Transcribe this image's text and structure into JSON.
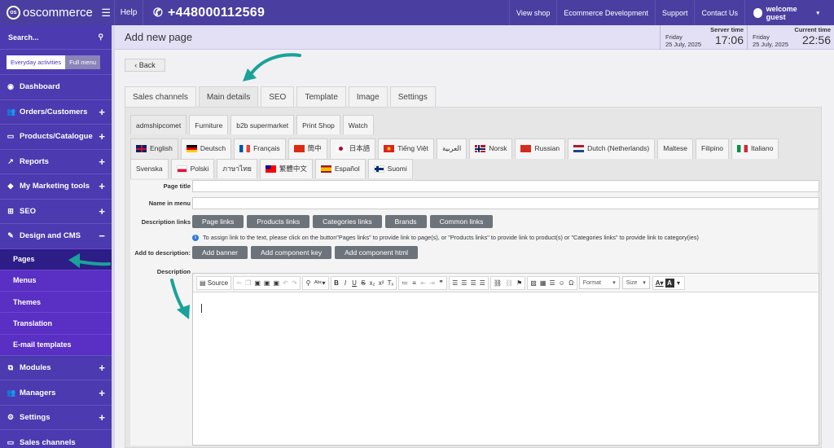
{
  "topbar": {
    "logo": "oscommerce",
    "logo_badge": "os",
    "menu_icon": "hamburger-icon",
    "help": "Help",
    "phone": "+448000112569",
    "links": [
      "View shop",
      "Ecommerce Development",
      "Support",
      "Contact Us"
    ],
    "welcome": "welcome guest"
  },
  "sidebar": {
    "search": "Search...",
    "toggle_everyday": "Everyday activities",
    "toggle_full": "Full menu",
    "items": [
      {
        "label": "Dashboard",
        "icon": "dashboard-icon",
        "expand": ""
      },
      {
        "label": "Orders/Customers",
        "icon": "users-icon",
        "expand": "+"
      },
      {
        "label": "Products/Catalogue",
        "icon": "folder-icon",
        "expand": "+"
      },
      {
        "label": "Reports",
        "icon": "chart-icon",
        "expand": "+"
      },
      {
        "label": "My Marketing tools",
        "icon": "tag-icon",
        "expand": "+"
      },
      {
        "label": "SEO",
        "icon": "sitemap-icon",
        "expand": "+"
      },
      {
        "label": "Design and CMS",
        "icon": "brush-icon",
        "expand": "−"
      }
    ],
    "subitems": [
      "Pages",
      "Menus",
      "Themes",
      "Translation",
      "E-mail templates"
    ],
    "items_after": [
      {
        "label": "Modules",
        "icon": "puzzle-icon",
        "expand": "+"
      },
      {
        "label": "Managers",
        "icon": "users-icon",
        "expand": "+"
      },
      {
        "label": "Settings",
        "icon": "gear-icon",
        "expand": "+"
      },
      {
        "label": "Sales channels",
        "icon": "monitor-icon",
        "expand": ""
      }
    ]
  },
  "header": {
    "title": "Add new page",
    "server_label": "Server time",
    "server_day": "Friday",
    "server_date": "25 July, 2025",
    "server_time": "17:06",
    "current_label": "Current time",
    "current_day": "Friday",
    "current_date": "25 July, 2025",
    "current_time": "22:56"
  },
  "back": "Back",
  "main_tabs": [
    "Sales channels",
    "Main details",
    "SEO",
    "Template",
    "Image",
    "Settings"
  ],
  "platform_tabs": [
    "admshipcomet",
    "Furniture",
    "b2b supermarket",
    "Print Shop",
    "Watch"
  ],
  "languages": [
    {
      "label": "English",
      "flag": "uk"
    },
    {
      "label": "Deutsch",
      "flag": "de"
    },
    {
      "label": "Français",
      "flag": "fr"
    },
    {
      "label": "簡中",
      "flag": "cn"
    },
    {
      "label": "日本語",
      "flag": "jp"
    },
    {
      "label": "Tiếng Việt",
      "flag": "vn"
    },
    {
      "label": "العربية",
      "flag": ""
    },
    {
      "label": "Norsk",
      "flag": "no"
    },
    {
      "label": "Russian",
      "flag": "ru"
    },
    {
      "label": "Dutch (Netherlands)",
      "flag": "nl"
    },
    {
      "label": "Maltese",
      "flag": ""
    },
    {
      "label": "Filipino",
      "flag": ""
    },
    {
      "label": "Italiano",
      "flag": "it"
    },
    {
      "label": "Svenska",
      "flag": ""
    },
    {
      "label": "Polski",
      "flag": "pl"
    },
    {
      "label": "ภาษาไทย",
      "flag": ""
    },
    {
      "label": "繁體中文",
      "flag": "tw"
    },
    {
      "label": "Español",
      "flag": "es"
    },
    {
      "label": "Suomi",
      "flag": "fi"
    }
  ],
  "form": {
    "page_title_label": "Page title",
    "name_in_menu_label": "Name in menu",
    "description_links_label": "Description links",
    "description_links": [
      "Page links",
      "Products links",
      "Categories links",
      "Brands",
      "Common links"
    ],
    "info": "To assign link to the text, please click on the button\"Pages links\" to provide link to page(s), or \"Products links\" to provide link to product(s) or \"Categories links\" to provide link to category(ies)",
    "add_to_description_label": "Add to description:",
    "add_buttons": [
      "Add banner",
      "Add component key",
      "Add component html"
    ],
    "description_label": "Description"
  },
  "editor": {
    "source": "Source",
    "format": "Format",
    "size": "Size"
  },
  "colors": {
    "topbar": "#4a3fa0",
    "sidebar": "#4c3ab0",
    "submenu": "#5a2fc4",
    "submenu_active": "#2d1d86",
    "annotation": "#1aa29a"
  }
}
